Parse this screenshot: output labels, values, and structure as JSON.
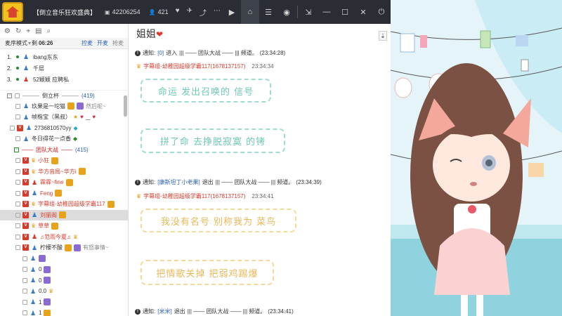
{
  "header": {
    "room_title": "【倒立音乐狂欢盛典】",
    "room_id": "42206254",
    "online_count": "421"
  },
  "left_panel": {
    "mode": "麦序模式",
    "countdown_label": "剩",
    "countdown_time": "06:26",
    "links": [
      "控麦",
      "开麦",
      "抢麦"
    ],
    "queue": [
      {
        "num": "1.",
        "name": "ibang东东"
      },
      {
        "num": "2.",
        "name": "千层"
      },
      {
        "num": "3.",
        "name": "52颖颖 应聘私"
      }
    ],
    "group1": {
      "name": "倒立杯",
      "count": "(419)"
    },
    "group1_members": [
      "玖果是一坨猫",
      "然后呢~",
      "帧楷宝（黑叔）",
      "2736810570yy",
      "冬日得花一点香"
    ],
    "group2": {
      "name": "团队大战",
      "count": "(415)"
    },
    "group2_members": [
      "小狂",
      "华方音局~华方i",
      "霖霖~fine",
      "Feng",
      "字幕组-幼稚园超级学霸117",
      "刘丽阁",
      "草草",
      "♫范雨今夏♫",
      "柠檬不酸",
      "有怒事情~"
    ],
    "extra_rows": [
      "0",
      "0",
      "0.0",
      "1",
      "1"
    ]
  },
  "chat": {
    "title": "姐姐",
    "messages": [
      {
        "type": "notice",
        "label": "通知:",
        "tag": "[0]",
        "action": "进入",
        "middle": "||| —— 团队大战 —— ||| 频道。",
        "time": "(23:34:28)"
      },
      {
        "type": "sender",
        "name": "字幕组-幼稚园超级学霸117(1678137157)",
        "time": "23:34:34"
      },
      {
        "type": "bubble",
        "text": "命运  发出召唤的  信号"
      },
      {
        "type": "bubble",
        "text": "拼了命  去挣脱寂寞  的铐"
      },
      {
        "type": "notice",
        "label": "通知:",
        "tag": "[康斯坦丁小老果]",
        "action": "退出",
        "middle": "||| —— 团队大战 —— ||| 频道。",
        "time": "(23:34:39)"
      },
      {
        "type": "sender",
        "name": "字幕组-幼稚园超级学霸117(1678137157)",
        "time": "23:34:41"
      },
      {
        "type": "bubble",
        "text": "我没有名号  别称我为  菜鸟"
      },
      {
        "type": "bubble",
        "text": "把情歌关掉  把弱鸡踢爆"
      },
      {
        "type": "notice",
        "label": "通知:",
        "tag": "[米米]",
        "action": "退出",
        "middle": "||| —— 团队大战 —— ||| 频道。",
        "time": "(23:34:41)"
      }
    ]
  },
  "colors": {
    "topbar": "#2a2d33",
    "name_red": "#d63a2b",
    "link_blue": "#2b62b8",
    "bubble_teal": "#6fc8b4",
    "bubble_gold": "#e8b85a"
  }
}
